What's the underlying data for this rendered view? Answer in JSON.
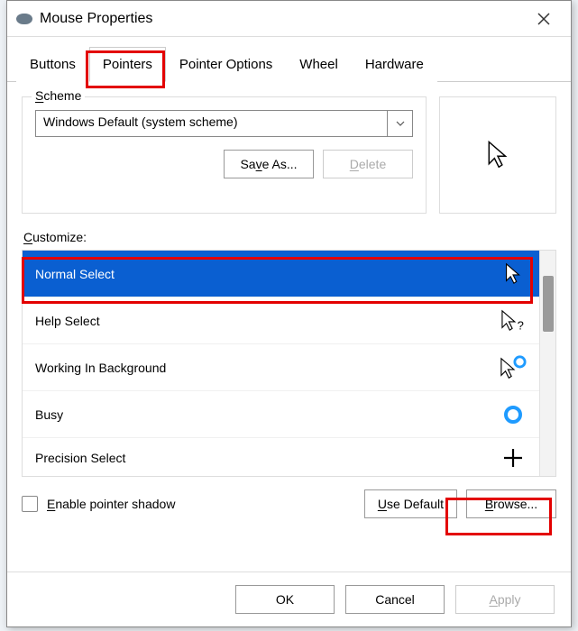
{
  "title": "Mouse Properties",
  "tabs": {
    "buttons": "Buttons",
    "pointers": "Pointers",
    "pointer_options": "Pointer Options",
    "wheel": "Wheel",
    "hardware": "Hardware",
    "active_index": 1
  },
  "scheme": {
    "legend_prefix": "S",
    "legend_rest": "cheme",
    "selected": "Windows Default (system scheme)",
    "save_as_prefix": "Sa",
    "save_as_u": "v",
    "save_as_rest": "e As...",
    "delete_u": "D",
    "delete_rest": "elete",
    "delete_enabled": false
  },
  "customize": {
    "label_u": "C",
    "label_rest": "ustomize:",
    "items": [
      {
        "label": "Normal Select",
        "icon": "arrow",
        "selected": true
      },
      {
        "label": "Help Select",
        "icon": "arrow-help",
        "selected": false
      },
      {
        "label": "Working In Background",
        "icon": "arrow-ring",
        "selected": false
      },
      {
        "label": "Busy",
        "icon": "ring",
        "selected": false
      },
      {
        "label": "Precision Select",
        "icon": "plus",
        "selected": false
      }
    ]
  },
  "shadow": {
    "label_u": "E",
    "label_rest": "nable pointer shadow",
    "checked": false
  },
  "action_buttons": {
    "use_default_u": "U",
    "use_default_rest": "se Default",
    "browse_u": "B",
    "browse_rest": "rowse..."
  },
  "footer": {
    "ok": "OK",
    "cancel": "Cancel",
    "apply_u": "A",
    "apply_rest": "pply",
    "apply_enabled": false
  },
  "highlights": {
    "tab_pointers": true,
    "item_normal_select": true,
    "button_browse": true
  }
}
